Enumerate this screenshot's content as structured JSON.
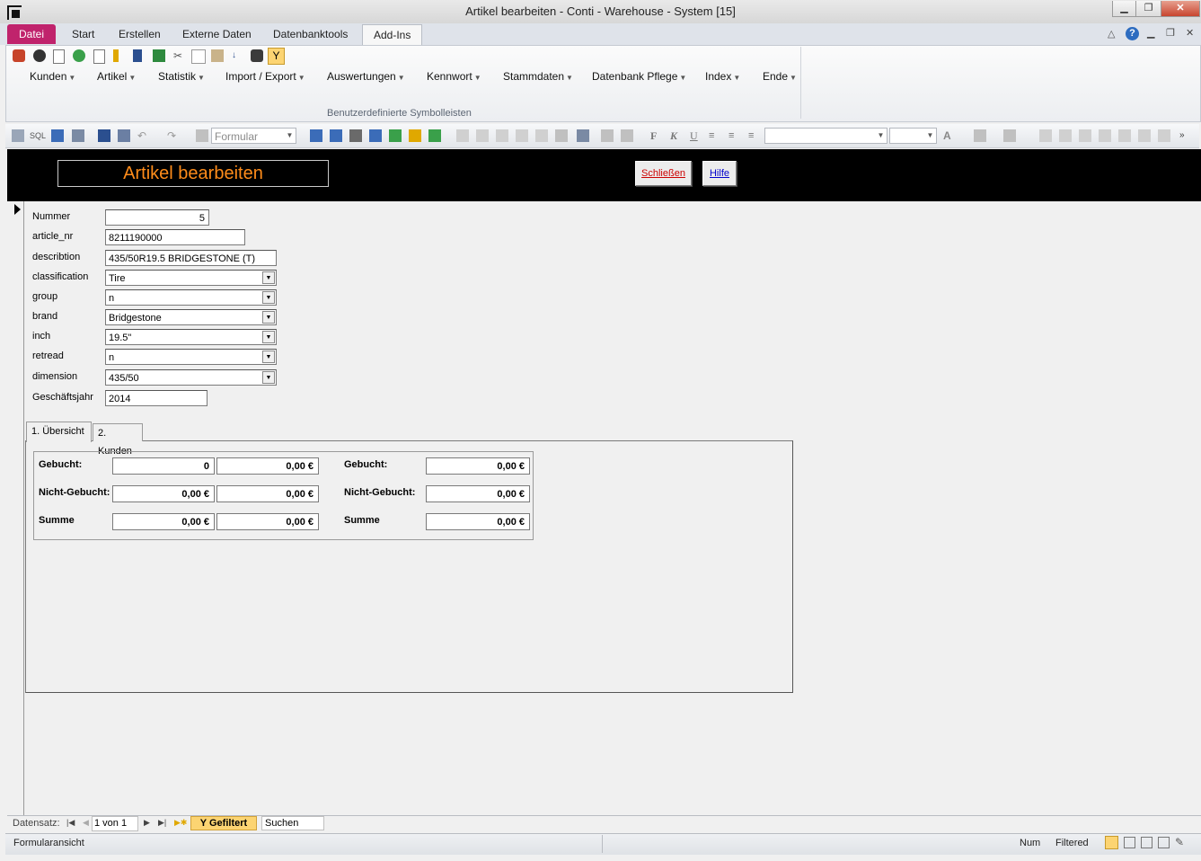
{
  "window": {
    "title": "Artikel bearbeiten  -  Conti - Warehouse - System [15]"
  },
  "ribbon_tabs": [
    "Datei",
    "Start",
    "Erstellen",
    "Externe Daten",
    "Datenbanktools",
    "Add-Ins"
  ],
  "ribbon": {
    "menus": [
      "Kunden",
      "Artikel",
      "Statistik",
      "Import / Export",
      "Auswertungen",
      "Kennwort",
      "Stammdaten",
      "Datenbank Pflege",
      "Index",
      "Ende"
    ],
    "group_label": "Benutzerdefinierte Symbolleisten"
  },
  "format_toolbar": {
    "object_combo": "Formular",
    "bold": "F",
    "italic": "K",
    "underline": "U",
    "font_color_letter": "A"
  },
  "form_header": {
    "title": "Artikel bearbeiten",
    "close_button": "Schließen",
    "help_button": "Hilfe"
  },
  "fields": [
    {
      "label": "Nummer",
      "value": "5"
    },
    {
      "label": "article_nr",
      "value": "8211190000"
    },
    {
      "label": "describtion",
      "value": "435/50R19.5 BRIDGESTONE (T)"
    },
    {
      "label": "classification",
      "value": "Tire"
    },
    {
      "label": "group",
      "value": "n"
    },
    {
      "label": "brand",
      "value": "Bridgestone"
    },
    {
      "label": "inch",
      "value": "19.5\""
    },
    {
      "label": "retread",
      "value": "n"
    },
    {
      "label": "dimension",
      "value": "435/50"
    },
    {
      "label": "Geschäftsjahr",
      "value": "2014"
    }
  ],
  "tabs": [
    "1. Übersicht",
    "2. Kunden"
  ],
  "summary": {
    "rows": [
      {
        "label": "Gebucht:",
        "v1": "0",
        "v2": "0,00 €",
        "label2": "Gebucht:",
        "v3": "0,00 €"
      },
      {
        "label": "Nicht-Gebucht:",
        "v1": "0,00 €",
        "v2": "0,00 €",
        "label2": "Nicht-Gebucht:",
        "v3": "0,00 €"
      },
      {
        "label": "Summe",
        "v1": "0,00 €",
        "v2": "0,00 €",
        "label2": "Summe",
        "v3": "0,00 €"
      }
    ]
  },
  "navigation": {
    "label": "Datensatz:",
    "record": "1 von 1",
    "filter": "Gefiltert",
    "search": "Suchen"
  },
  "status": {
    "view": "Formularansicht",
    "num": "Num",
    "filtered": "Filtered"
  },
  "colors": {
    "file_tab": "#c0236c",
    "form_title": "#ff8c1a",
    "header_bg": "#000000",
    "close_text": "#cc0000",
    "help_text": "#0000cc"
  }
}
